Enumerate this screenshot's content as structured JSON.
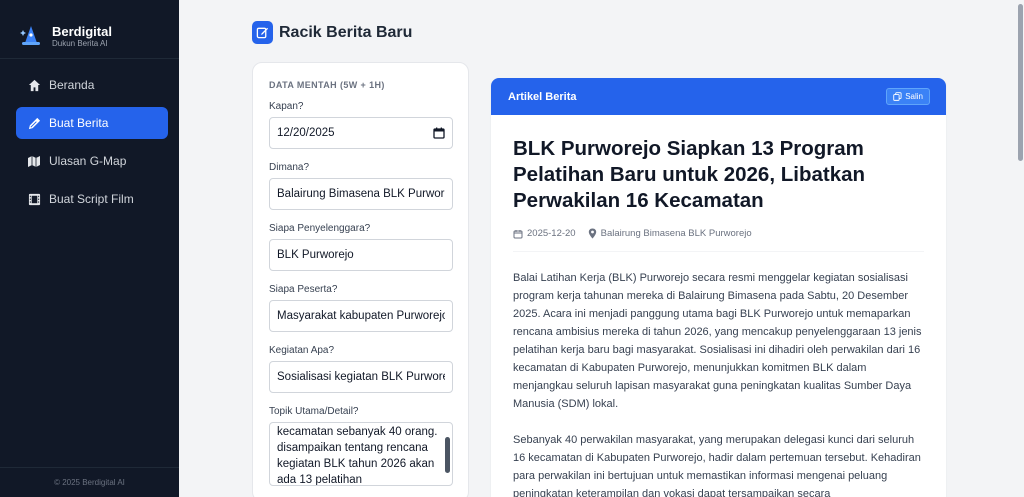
{
  "brand": {
    "name": "Berdigital",
    "tagline": "Dukun Berita AI"
  },
  "sidebar": {
    "items": [
      {
        "label": "Beranda",
        "icon": "home-icon",
        "active": false
      },
      {
        "label": "Buat Berita",
        "icon": "pen-icon",
        "active": true
      },
      {
        "label": "Ulasan G-Map",
        "icon": "map-icon",
        "active": false
      },
      {
        "label": "Buat Script Film",
        "icon": "film-icon",
        "active": false
      }
    ],
    "footer": "© 2025 Berdigital AI"
  },
  "page": {
    "title": "Racik Berita Baru"
  },
  "form": {
    "section_label": "DATA MENTAH (5W + 1H)",
    "when": {
      "label": "Kapan?",
      "value": "12/20/2025"
    },
    "where": {
      "label": "Dimana?",
      "value": "Balairung Bimasena BLK Purworejo"
    },
    "organizer": {
      "label": "Siapa Penyelenggara?",
      "value": "BLK Purworejo"
    },
    "participants": {
      "label": "Siapa Peserta?",
      "value": "Masyarakat kabupaten Purworejo"
    },
    "activity": {
      "label": "Kegiatan Apa?",
      "value": "Sosialisasi kegiatan BLK Purworejo"
    },
    "topic": {
      "label": "Topik Utama/Detail?",
      "lines": [
        "kecamatan sebanyak 40 orang.",
        "disampaikan tentang rencana",
        "kegiatan BLK tahun 2026 akan",
        "ada 13 pelatihan"
      ]
    }
  },
  "article": {
    "header_title": "Artikel Berita",
    "copy_label": "Salin",
    "headline": "BLK Purworejo Siapkan 13 Program Pelatihan Baru untuk 2026, Libatkan Perwakilan 16 Kecamatan",
    "date": "2025-12-20",
    "location": "Balairung Bimasena BLK Purworejo",
    "paragraphs": [
      "Balai Latihan Kerja (BLK) Purworejo secara resmi menggelar kegiatan sosialisasi program kerja tahunan mereka di Balairung Bimasena pada Sabtu, 20 Desember 2025. Acara ini menjadi panggung utama bagi BLK Purworejo untuk memaparkan rencana ambisius mereka di tahun 2026, yang mencakup penyelenggaraan 13 jenis pelatihan kerja baru bagi masyarakat. Sosialisasi ini dihadiri oleh perwakilan dari 16 kecamatan di Kabupaten Purworejo, menunjukkan komitmen BLK dalam menjangkau seluruh lapisan masyarakat guna peningkatan kualitas Sumber Daya Manusia (SDM) lokal.",
      "Sebanyak 40 perwakilan masyarakat, yang merupakan delegasi kunci dari seluruh 16 kecamatan di Kabupaten Purworejo, hadir dalam pertemuan tersebut. Kehadiran para perwakilan ini bertujuan untuk memastikan informasi mengenai peluang peningkatan keterampilan dan vokasi dapat tersampaikan secara"
    ]
  },
  "colors": {
    "accent": "#2563eb",
    "sidebar_bg": "#111827",
    "page_bg": "#f3f4f6"
  }
}
